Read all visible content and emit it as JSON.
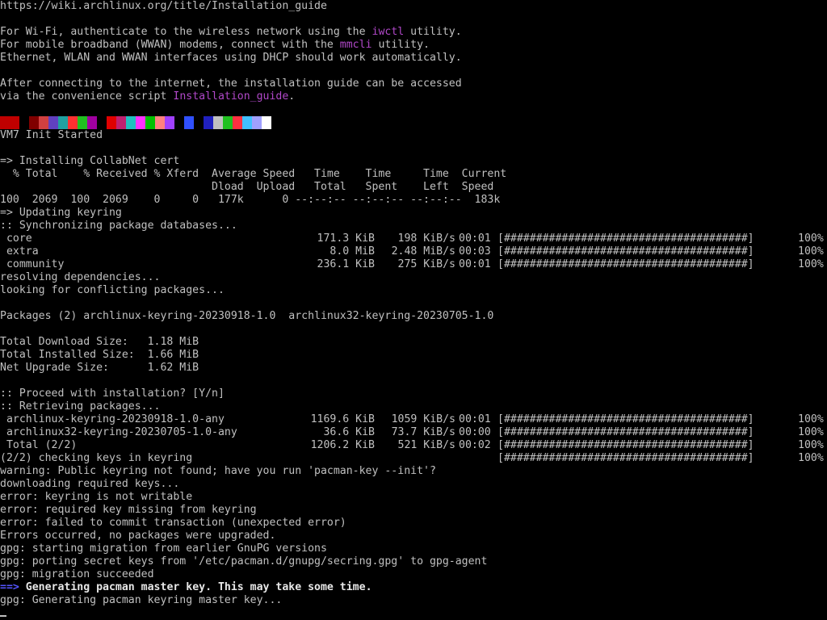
{
  "terminal": {
    "url": "https://wiki.archlinux.org/title/Installation_guide",
    "wifi": {
      "before": "For Wi-Fi, authenticate to the wireless network using the ",
      "highlight": "iwctl",
      "after": " utility."
    },
    "wwan": {
      "before": "For mobile broadband (WWAN) modems, connect with the ",
      "highlight": "mmcli",
      "after": " utility."
    },
    "dhcp": "Ethernet, WLAN and WWAN interfaces using DHCP should work automatically.",
    "after_connect": "After connecting to the internet, the installation guide can be accessed",
    "script": {
      "before": "via the convenience script ",
      "highlight": "Installation_guide",
      "after": "."
    },
    "color_strip": [
      "#c00000",
      "#c00000",
      "#000000",
      "#800000",
      "#d04040",
      "#6040c0",
      "#20a0a0",
      "#ff3030",
      "#20c020",
      "#a000a0",
      "#000000",
      "#e00000",
      "#c02070",
      "#20c0c0",
      "#ff30ff",
      "#00c000",
      "#ff8080",
      "#a040ff",
      "#000000",
      "#3050ff",
      "#000000",
      "#2020c0",
      "#c0c0c0",
      "#20c020",
      "#ff3040",
      "#40c0ff",
      "#a0a0ff",
      "#ffffff"
    ],
    "init_started": "VM7 Init Started",
    "collabnet": "=> Installing CollabNet cert",
    "curl_header1": "  % Total    % Received % Xferd  Average Speed   Time    Time     Time  Current",
    "curl_header2": "                                 Dload  Upload   Total   Spent    Left  Speed",
    "curl_row": "100  2069  100  2069    0     0   177k      0 --:--:-- --:--:-- --:--:--  183k",
    "updating_keyring": "=> Updating keyring",
    "sync_db": ":: Synchronizing package databases...",
    "db_rows": [
      {
        "name": " core",
        "size": "171.3 KiB",
        "speed": "198 KiB/s",
        "time": "00:01",
        "bar": "[######################################]",
        "pct": "100%"
      },
      {
        "name": " extra",
        "size": "8.0 MiB",
        "speed": "2.48 MiB/s",
        "time": "00:03",
        "bar": "[######################################]",
        "pct": "100%"
      },
      {
        "name": " community",
        "size": "236.1 KiB",
        "speed": "275 KiB/s",
        "time": "00:01",
        "bar": "[######################################]",
        "pct": "100%"
      }
    ],
    "resolving": "resolving dependencies...",
    "conflicts": "looking for conflicting packages...",
    "packages": "Packages (2) archlinux-keyring-20230918-1.0  archlinux32-keyring-20230705-1.0",
    "total_download": "Total Download Size:   1.18 MiB",
    "total_installed": "Total Installed Size:  1.66 MiB",
    "net_upgrade": "Net Upgrade Size:      1.62 MiB",
    "proceed": ":: Proceed with installation? [Y/n]",
    "retrieving": ":: Retrieving packages...",
    "pkg_rows": [
      {
        "name": " archlinux-keyring-20230918-1.0-any",
        "size": "1169.6 KiB",
        "speed": "1059 KiB/s",
        "time": "00:01",
        "bar": "[######################################]",
        "pct": "100%"
      },
      {
        "name": " archlinux32-keyring-20230705-1.0-any",
        "size": "36.6 KiB",
        "speed": "73.7 KiB/s",
        "time": "00:00",
        "bar": "[######################################]",
        "pct": "100%"
      },
      {
        "name": " Total (2/2)",
        "size": "1206.2 KiB",
        "speed": "521 KiB/s",
        "time": "00:02",
        "bar": "[######################################]",
        "pct": "100%"
      }
    ],
    "checking_keys": {
      "name": "(2/2) checking keys in keyring",
      "bar": "[######################################]",
      "pct": "100%"
    },
    "log": [
      "warning: Public keyring not found; have you run 'pacman-key --init'?",
      "downloading required keys...",
      "error: keyring is not writable",
      "error: required key missing from keyring",
      "error: failed to commit transaction (unexpected error)",
      "Errors occurred, no packages were upgraded.",
      "gpg: starting migration from earlier GnuPG versions",
      "gpg: porting secret keys from '/etc/pacman.d/gnupg/secring.gpg' to gpg-agent",
      "gpg: migration succeeded"
    ],
    "master_key": {
      "arrow": "==>",
      "text": " Generating pacman master key. This may take some time."
    },
    "last_line": "gpg: Generating pacman keyring master key...",
    "colors": {
      "foreground": "#c0c0c0",
      "background": "#000000",
      "highlight": "#b048c8",
      "arrow": "#5555ff"
    }
  }
}
